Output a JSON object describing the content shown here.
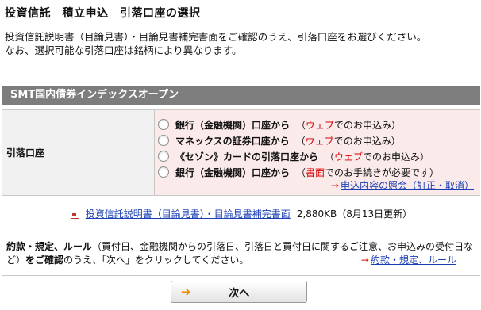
{
  "page": {
    "title": "投資信託　積立申込　引落口座の選択"
  },
  "intro": {
    "line1": "投資信託説明書（目論見書）・目論見書補完書面をご確認のうえ、引落口座をお選びください。",
    "line2": "なお、選択可能な引落口座は銘柄により異なります。"
  },
  "fund": {
    "name": "SMT国内債券インデックスオープン"
  },
  "account": {
    "label": "引落口座",
    "options": [
      {
        "main": "銀行（金融機関）口座から",
        "paren_open": "（",
        "highlight": "ウェブ",
        "rest": "でのお申込み）"
      },
      {
        "main": "マネックスの証券口座から",
        "paren_open": "（",
        "highlight": "ウェブ",
        "rest": "でのお申込み）"
      },
      {
        "main": "《セゾン》カードの引落口座から",
        "paren_open": "（",
        "highlight": "ウェブ",
        "rest": "でのお申込み）"
      },
      {
        "main": "銀行（金融機関）口座から",
        "paren_open": "（",
        "highlight": "書面",
        "rest": "でのお手続きが必要です）"
      }
    ],
    "inquiry_arrow": "→",
    "inquiry_link": "申込内容の照会（訂正・取消）"
  },
  "document": {
    "link": "投資信託説明書（目論見書）・目論見書補完書面",
    "size": "2,880KB",
    "updated": "（8月13日更新）"
  },
  "terms": {
    "bold_label": "約款・規定、ルール",
    "text": "（買付日、金融機関からの引落日、引落日と買付日に関するご注意、お申込みの受付日など）",
    "confirm_bold": "をご確認",
    "confirm_rest": "のうえ、「次へ」をクリックしてください。",
    "link_arrow": "→",
    "link": "約款・規定、ルール"
  },
  "next_button": {
    "arrow": "➔",
    "label": "次へ"
  },
  "colors": {
    "header_bg": "#7d7d7d",
    "options_bg": "#fbeaea",
    "highlight_red": "#d60000",
    "link_blue": "#1a3fb3",
    "next_arrow": "#f08a00"
  }
}
